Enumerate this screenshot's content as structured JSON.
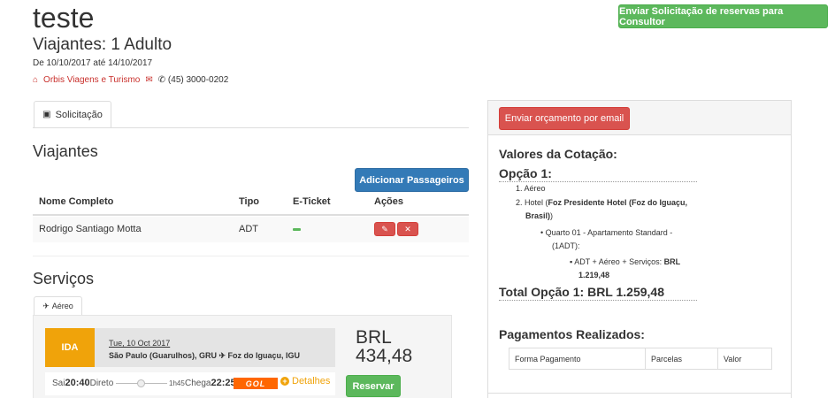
{
  "header": {
    "title": "teste",
    "travelers": "Viajantes: 1 Adulto",
    "dates": "De 10/10/2017 até 14/10/2017",
    "agency": "Orbis Viagens e Turismo",
    "phone": "(45) 3000-0202",
    "send_consultant_label": "Enviar Solicitação de reservas para Consultor"
  },
  "tabs": {
    "solicitacao": "Solicitação"
  },
  "viajantes": {
    "heading": "Viajantes",
    "add_button": "Adicionar Passageiros",
    "columns": [
      "Nome Completo",
      "Tipo",
      "E-Ticket",
      "Ações"
    ],
    "rows": [
      {
        "name": "Rodrigo Santiago Motta",
        "type": "ADT"
      }
    ]
  },
  "servicos": {
    "heading": "Serviços",
    "tab": "Aéreo",
    "flight": {
      "badge": "IDA",
      "date": "Tue, 10 Oct 2017",
      "route": "São Paulo (Guarulhos), GRU ✈ Foz do Iguaçu, IGU",
      "currency": "BRL",
      "price": "434,48",
      "sai_label": "Sai",
      "sai_time": "20:40",
      "direto": "Direto",
      "duration": "1h45",
      "chega_label": "Chega",
      "chega_time": "22:25",
      "airline": "GOL",
      "details": "Detalhes",
      "reserve_button": "Reservar"
    }
  },
  "cotacao": {
    "email_button": "Enviar orçamento por email",
    "heading": "Valores da Cotação:",
    "option_title": "Opção 1:",
    "items": {
      "aereo": "Aéreo",
      "hotel_prefix": "Hotel (",
      "hotel_name": "Foz Presidente Hotel (Foz do Iguaçu,",
      "hotel_name_2": "Brasil)",
      "hotel_suffix": ")",
      "room": "Quarto 01 - Apartamento Standard -",
      "room_2": "(1ADT):",
      "services_prefix": "ADT + Aéreo + Serviços:",
      "services_value": "BRL",
      "services_value_2": "1.219,48"
    },
    "total": "Total Opção 1: BRL 1.259,48",
    "payments_heading": "Pagamentos Realizados:",
    "payments_columns": [
      "Forma Pagamento",
      "Parcelas",
      "Valor"
    ]
  },
  "colors": {
    "green": "#5cb85c",
    "blue": "#337ab7",
    "red": "#d9534f",
    "orange": "#f0a30a",
    "gol_orange": "#ff6600"
  }
}
